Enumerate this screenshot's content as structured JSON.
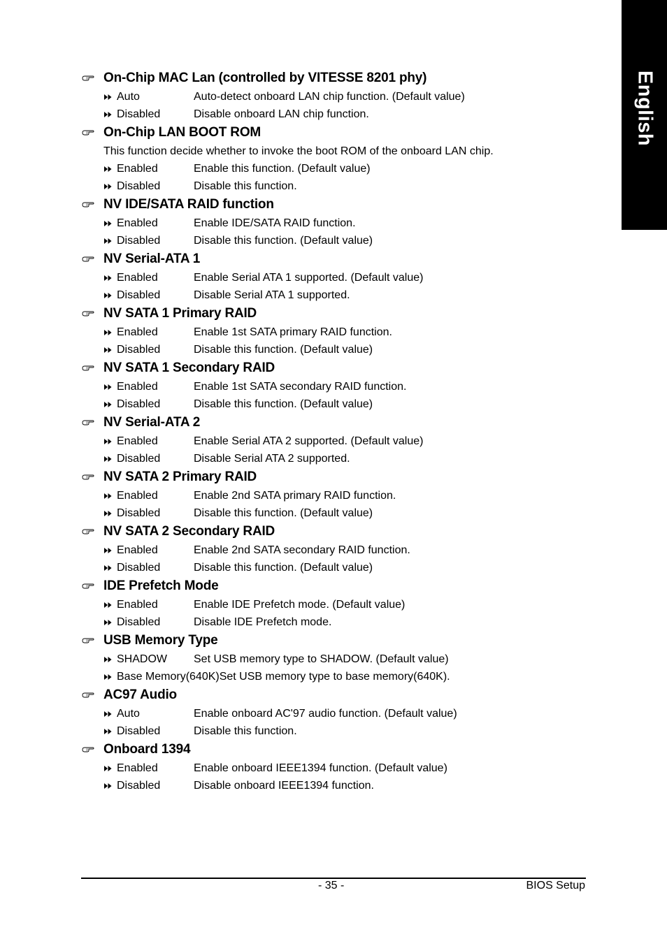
{
  "side_tab": {
    "label": "English"
  },
  "sections": [
    {
      "title": "On-Chip MAC Lan (controlled by VITESSE 8201 phy)",
      "description": null,
      "options": [
        {
          "name": "Auto",
          "desc": "Auto-detect onboard LAN chip function. (Default value)"
        },
        {
          "name": "Disabled",
          "desc": "Disable onboard LAN chip function."
        }
      ]
    },
    {
      "title": "On-Chip LAN BOOT ROM",
      "description": "This function decide whether to invoke the boot ROM of the onboard LAN chip.",
      "options": [
        {
          "name": "Enabled",
          "desc": "Enable this function. (Default value)"
        },
        {
          "name": "Disabled",
          "desc": "Disable this function."
        }
      ]
    },
    {
      "title": "NV IDE/SATA RAID function",
      "description": null,
      "options": [
        {
          "name": "Enabled",
          "desc": "Enable IDE/SATA RAID function."
        },
        {
          "name": "Disabled",
          "desc": "Disable this function. (Default value)"
        }
      ]
    },
    {
      "title": "NV Serial-ATA 1",
      "description": null,
      "options": [
        {
          "name": "Enabled",
          "desc": "Enable Serial ATA 1 supported. (Default value)"
        },
        {
          "name": "Disabled",
          "desc": "Disable Serial ATA 1 supported."
        }
      ]
    },
    {
      "title": "NV SATA 1 Primary RAID",
      "description": null,
      "options": [
        {
          "name": "Enabled",
          "desc": "Enable 1st SATA primary RAID function."
        },
        {
          "name": "Disabled",
          "desc": "Disable this function. (Default value)"
        }
      ]
    },
    {
      "title": "NV SATA 1 Secondary RAID",
      "description": null,
      "options": [
        {
          "name": "Enabled",
          "desc": "Enable 1st SATA secondary RAID function."
        },
        {
          "name": "Disabled",
          "desc": "Disable this function. (Default value)"
        }
      ]
    },
    {
      "title": "NV Serial-ATA 2",
      "description": null,
      "options": [
        {
          "name": "Enabled",
          "desc": "Enable Serial ATA 2 supported. (Default value)"
        },
        {
          "name": "Disabled",
          "desc": "Disable Serial ATA 2 supported."
        }
      ]
    },
    {
      "title": "NV SATA 2 Primary RAID",
      "description": null,
      "options": [
        {
          "name": "Enabled",
          "desc": "Enable 2nd SATA primary RAID function."
        },
        {
          "name": "Disabled",
          "desc": "Disable this function. (Default value)"
        }
      ]
    },
    {
      "title": "NV SATA 2 Secondary RAID",
      "description": null,
      "options": [
        {
          "name": "Enabled",
          "desc": "Enable 2nd SATA secondary RAID function."
        },
        {
          "name": "Disabled",
          "desc": "Disable this function. (Default value)"
        }
      ]
    },
    {
      "title": "IDE Prefetch Mode",
      "description": null,
      "options": [
        {
          "name": "Enabled",
          "desc": "Enable IDE Prefetch mode. (Default value)"
        },
        {
          "name": "Disabled",
          "desc": "Disable IDE Prefetch mode."
        }
      ]
    },
    {
      "title": "USB Memory Type",
      "description": null,
      "options": [
        {
          "name": "SHADOW",
          "desc": "Set USB memory type to SHADOW. (Default value)"
        },
        {
          "name": "Base Memory(640K)",
          "desc": "Set USB memory type to base memory(640K).",
          "wide": true
        }
      ]
    },
    {
      "title": "AC97 Audio",
      "description": null,
      "options": [
        {
          "name": "Auto",
          "desc": "Enable onboard AC'97 audio function. (Default value)"
        },
        {
          "name": "Disabled",
          "desc": "Disable this function."
        }
      ]
    },
    {
      "title": "Onboard 1394",
      "description": null,
      "options": [
        {
          "name": "Enabled",
          "desc": "Enable onboard IEEE1394 function. (Default value)"
        },
        {
          "name": "Disabled",
          "desc": "Disable onboard IEEE1394 function."
        }
      ]
    }
  ],
  "footer": {
    "page_number": "- 35 -",
    "chapter": "BIOS Setup"
  },
  "icons": {
    "section_bullet": "pointing-hand-icon",
    "option_bullet": "double-arrow-right-icon"
  }
}
